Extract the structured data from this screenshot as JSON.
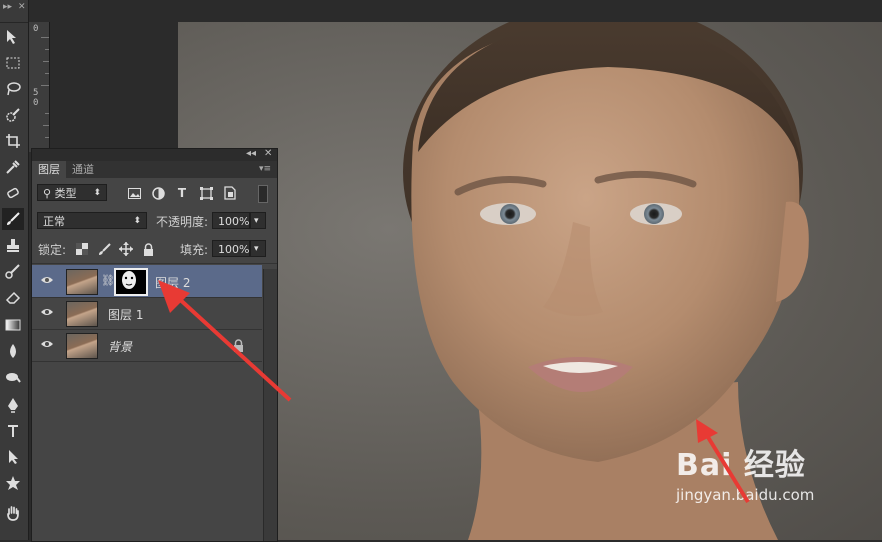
{
  "ruler": {
    "mark_0": "0",
    "mark_5": "5",
    "mark_0b": "0"
  },
  "panel": {
    "tabs": [
      "图层",
      "通道"
    ],
    "filter_kind": "类型",
    "blend_mode": "正常",
    "opacity_label": "不透明度:",
    "opacity_value": "100%",
    "lock_label": "锁定:",
    "fill_label": "填充:",
    "fill_value": "100%",
    "layers": [
      {
        "name": "图层 2",
        "has_mask": true,
        "selected": true
      },
      {
        "name": "图层 1",
        "has_mask": false,
        "selected": false
      },
      {
        "name": "背景",
        "has_mask": false,
        "selected": false,
        "locked": true
      }
    ]
  },
  "watermark": {
    "brand": "Bai  经验",
    "url": "jingyan.baidu.com"
  },
  "colors": {
    "selection": "#5b6a8a",
    "arrow": "#e83a34"
  }
}
